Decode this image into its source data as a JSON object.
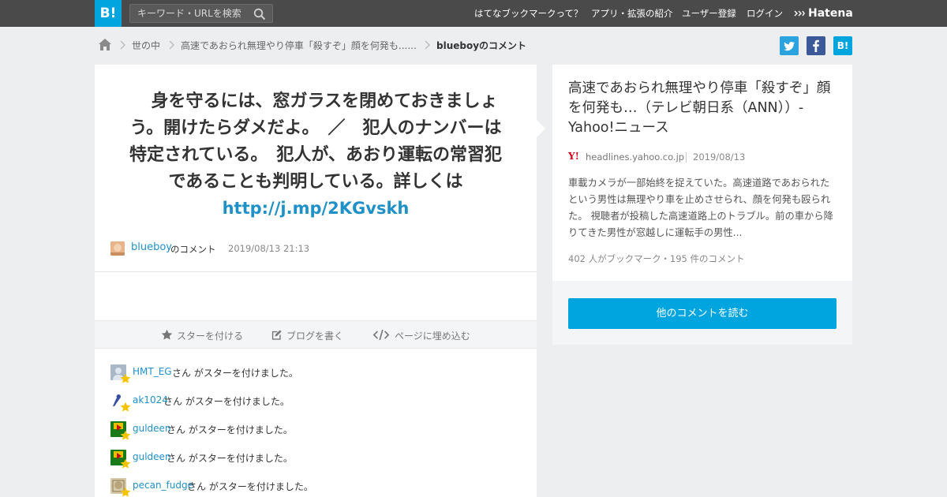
{
  "header": {
    "logo_label": "B!",
    "search_placeholder": "キーワード・URLを検索",
    "nav": [
      "はてなブックマークって？",
      "アプリ・拡張の紹介",
      "ユーザー登録",
      "ログイン"
    ],
    "brand": "Hatena"
  },
  "breadcrumb": {
    "items": [
      "世の中",
      "高速であおられ無理やり停車「殺すぞ」顔を何発も......"
    ],
    "current": "blueboyのコメント"
  },
  "share": {
    "twitter_icon": "twitter-icon",
    "facebook_icon": "facebook-icon",
    "hatena_label": "B!",
    "colors": {
      "twitter": "#1da1f2",
      "facebook": "#3b5998",
      "hatena": "#00a4de"
    }
  },
  "comment": {
    "lines": [
      "　身を守るには、窓ガラスを閉めておきましょ",
      "う。開けたらダメだよ。　／　犯人のナンバーは",
      "特定されている。　犯人が、あおり運転の常習犯",
      "であることも判明している。詳しくは"
    ],
    "link": "http://j.mp/2KGvskh",
    "author": "blueboy",
    "author_suffix": "のコメント",
    "date": "2019/08/13 21:13"
  },
  "actions": {
    "star": "スターを付ける",
    "blog": "ブログを書く",
    "embed": "ページに埋め込む"
  },
  "stars": {
    "message": "さん がスターを付けました。",
    "users": [
      "HMT_EG",
      "ak1024",
      "guldeen",
      "guldeen",
      "pecan_fudge"
    ]
  },
  "article": {
    "title": "高速であおられ無理やり停車「殺すぞ」顔を何発も…（テレビ朝日系（ANN））-Yahoo!ニュース",
    "source_logo": "Y!",
    "domain": "headlines.yahoo.co.jp",
    "date": "2019/08/13",
    "summary": "車載カメラが一部始終を捉えていた。高速道路であおられたという男性は無理やり車を止めさせられ、顔を何発も殴られた。 視聴者が投稿した高速道路上のトラブル。前の車から降りてきた男性が窓越しに運転手の男性...",
    "stats": "402 人がブックマーク・195 件のコメント",
    "read_more": "他のコメントを読む"
  },
  "colors": {
    "accent": "#00a4de",
    "link": "#2090c8",
    "header": "#4a4a4a",
    "star": "#f5c400"
  }
}
